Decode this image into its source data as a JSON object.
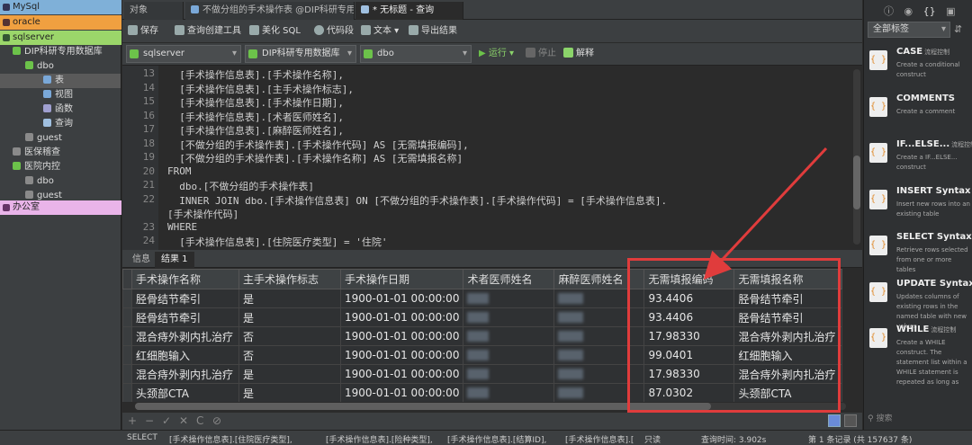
{
  "nav": {
    "connections": [
      {
        "label": "MySql",
        "color": "#7fb0d8"
      },
      {
        "label": "oracle",
        "color": "#f0a040"
      },
      {
        "label": "sqlserver",
        "color": "#9bd66a"
      }
    ],
    "tree": [
      {
        "label": "DIP科研专用数据库",
        "indent": 1
      },
      {
        "label": "dbo",
        "indent": 2
      },
      {
        "label": "表",
        "indent": 3,
        "selected": true
      },
      {
        "label": "视图",
        "indent": 3
      },
      {
        "label": "函数",
        "indent": 3
      },
      {
        "label": "查询",
        "indent": 3
      },
      {
        "label": "guest",
        "indent": 2
      },
      {
        "label": "医保稽查",
        "indent": 1
      },
      {
        "label": "医院内控",
        "indent": 1
      },
      {
        "label": "dbo",
        "indent": 2
      },
      {
        "label": "guest",
        "indent": 2
      }
    ],
    "office": {
      "label": "办公室",
      "color": "#e9b4e9"
    }
  },
  "tabs": [
    {
      "label": "对象",
      "active": false
    },
    {
      "label": "不做分组的手术操作表 @DIP科研专用...",
      "active": false
    },
    {
      "label": "* 无标题 - 查询",
      "active": true
    }
  ],
  "toolbar1": {
    "save": "保存",
    "query_builder": "查询创建工具",
    "beautify": "美化 SQL",
    "snippet": "代码段",
    "text": "文本",
    "export": "导出结果"
  },
  "toolbar2": {
    "connection": "sqlserver",
    "database": "DIP科研专用数据库",
    "schema": "dbo",
    "run": "运行",
    "stop": "停止",
    "explain": "解释"
  },
  "editor": {
    "lines": [
      {
        "n": "13",
        "text": "  [手术操作信息表].[手术操作名称],"
      },
      {
        "n": "14",
        "text": "  [手术操作信息表].[主手术操作标志],"
      },
      {
        "n": "15",
        "text": "  [手术操作信息表].[手术操作日期],"
      },
      {
        "n": "16",
        "text": "  [手术操作信息表].[术者医师姓名],"
      },
      {
        "n": "17",
        "text": "  [手术操作信息表].[麻醉医师姓名],"
      },
      {
        "n": "18",
        "text": "  [不做分组的手术操作表].[手术操作代码] AS [无需填报编码],"
      },
      {
        "n": "19",
        "text": "  [不做分组的手术操作表].[手术操作名称] AS [无需填报名称]"
      },
      {
        "n": "20",
        "text": "FROM"
      },
      {
        "n": "21",
        "text": "  dbo.[不做分组的手术操作表]"
      },
      {
        "n": "22",
        "text": "  INNER JOIN dbo.[手术操作信息表] ON [不做分组的手术操作表].[手术操作代码] = [手术操作信息表]."
      },
      {
        "n": "",
        "text": "[手术操作代码]"
      },
      {
        "n": "23",
        "text": "WHERE"
      },
      {
        "n": "24",
        "text": "  [手术操作信息表].[住院医疗类型] = '住院'"
      }
    ]
  },
  "result_tabs": [
    "信息",
    "结果 1"
  ],
  "grid": {
    "columns": [
      "手术操作名称",
      "主手术操作标志",
      "手术操作日期",
      "术者医师姓名",
      "麻醉医师姓名",
      "无需填报编码",
      "无需填报名称"
    ],
    "rows": [
      [
        "胫骨结节牵引",
        "是",
        "1900-01-01 00:00:00",
        "",
        "",
        "93.4406",
        "胫骨结节牵引"
      ],
      [
        "胫骨结节牵引",
        "是",
        "1900-01-01 00:00:00",
        "",
        "",
        "93.4406",
        "胫骨结节牵引"
      ],
      [
        "混合痔外剥内扎治疗",
        "否",
        "1900-01-01 00:00:00",
        "",
        "",
        "17.98330",
        "混合痔外剥内扎治疗"
      ],
      [
        "红细胞输入",
        "否",
        "1900-01-01 00:00:00",
        "",
        "",
        "99.0401",
        "红细胞输入"
      ],
      [
        "混合痔外剥内扎治疗",
        "是",
        "1900-01-01 00:00:00",
        "",
        "",
        "17.98330",
        "混合痔外剥内扎治疗"
      ],
      [
        "头颈部CTA",
        "是",
        "1900-01-01 00:00:00",
        "",
        "",
        "87.0302",
        "头颈部CTA"
      ]
    ]
  },
  "bottom_icons": [
    "+",
    "−",
    "✓",
    "✕",
    "C",
    "⊘"
  ],
  "status": {
    "sql": "SELECT",
    "f1": "[手术操作信息表].[住院医疗类型],",
    "f2": "[手术操作信息表].[险种类型],",
    "f3": "[手术操作信息表].[结算ID],",
    "f4": "[手术操作信息表].[",
    "readonly": "只读",
    "query_time": "查询时间: 3.902s",
    "records": "第 1 条记录 (共 157637 条)"
  },
  "right_panel": {
    "filter": "全部标签",
    "search_placeholder": "搜索",
    "snippets": [
      {
        "title": "CASE",
        "tag": "流程控制",
        "desc": "Create a conditional construct"
      },
      {
        "title": "COMMENTS",
        "tag": "",
        "desc": "Create a comment"
      },
      {
        "title": "IF...ELSE...",
        "tag": "流程控制",
        "desc": "Create a IF...ELSE... construct"
      },
      {
        "title": "INSERT Syntax",
        "tag": "",
        "desc": "Insert new rows into an existing table"
      },
      {
        "title": "SELECT Syntax",
        "tag": "",
        "desc": "Retrieve rows selected from one or more tables"
      },
      {
        "title": "UPDATE Syntax",
        "tag": "",
        "desc": "Updates columns of existing rows in the named table with new values"
      },
      {
        "title": "WHILE",
        "tag": "流程控制",
        "desc": "Create a WHILE construct. The statement list within a WHILE statement is repeated as long as"
      }
    ]
  },
  "colors": {
    "accent_green": "#6cc24a",
    "highlight_red": "#e03c3c",
    "editor_bg": "#2b2b2b"
  }
}
